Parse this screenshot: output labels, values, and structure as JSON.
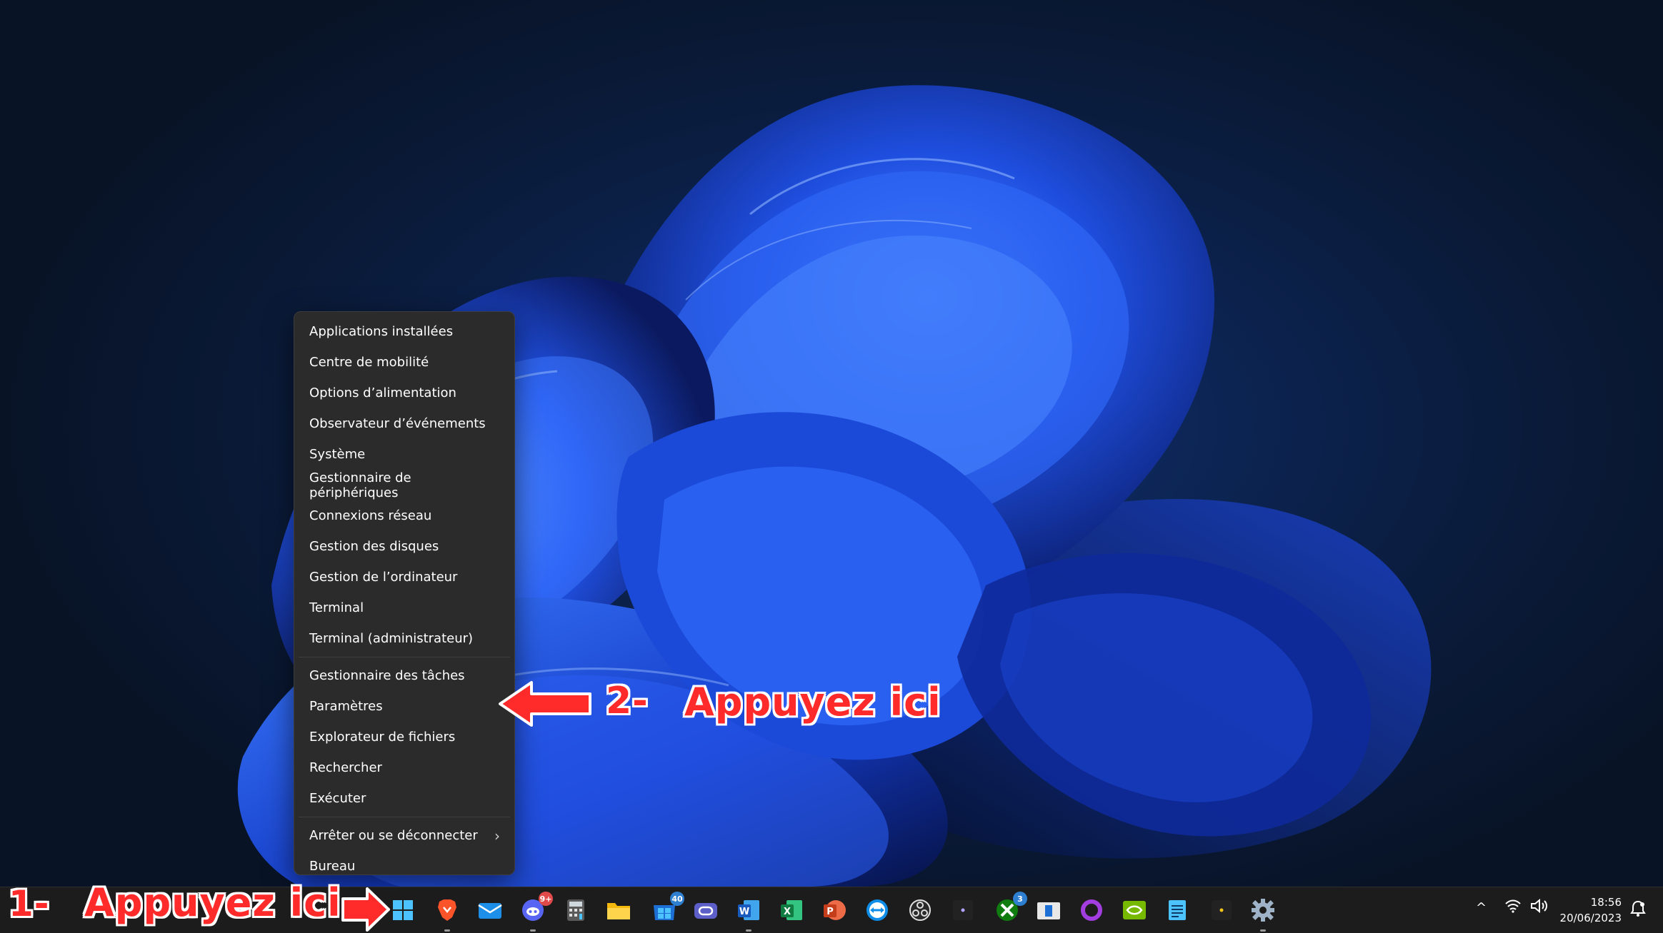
{
  "menu": {
    "group1": [
      {
        "label": "Applications installées"
      },
      {
        "label": "Centre de mobilité"
      },
      {
        "label": "Options d’alimentation"
      },
      {
        "label": "Observateur d’événements"
      },
      {
        "label": "Système"
      },
      {
        "label": "Gestionnaire de périphériques"
      },
      {
        "label": "Connexions réseau"
      },
      {
        "label": "Gestion des disques"
      },
      {
        "label": "Gestion de l’ordinateur"
      },
      {
        "label": "Terminal"
      },
      {
        "label": "Terminal (administrateur)"
      }
    ],
    "group2": [
      {
        "label": "Gestionnaire des tâches"
      },
      {
        "label": "Paramètres"
      },
      {
        "label": "Explorateur de fichiers"
      },
      {
        "label": "Rechercher"
      },
      {
        "label": "Exécuter"
      }
    ],
    "group3": [
      {
        "label": "Arrêter ou se déconnecter",
        "chevron": "›"
      },
      {
        "label": "Bureau"
      }
    ]
  },
  "annotations": {
    "step1_number": "1-",
    "step1_text": "Appuyez ici",
    "step2_number": "2-",
    "step2_text": "Appuyez ici",
    "color": "#ff2a2a"
  },
  "taskbar": {
    "apps": [
      {
        "icon": "windows-start-icon"
      },
      {
        "icon": "brave-browser-icon"
      },
      {
        "icon": "mail-icon"
      },
      {
        "icon": "discord-icon",
        "badge": "9+"
      },
      {
        "icon": "calculator-icon"
      },
      {
        "icon": "file-explorer-icon"
      },
      {
        "icon": "microsoft-store-icon",
        "badge": "40"
      },
      {
        "icon": "app-icon"
      },
      {
        "icon": "word-icon",
        "text": "W"
      },
      {
        "icon": "excel-icon",
        "text": "X"
      },
      {
        "icon": "powerpoint-icon",
        "text": "P"
      },
      {
        "icon": "teamviewer-icon"
      },
      {
        "icon": "obs-icon"
      },
      {
        "icon": "small-dot-icon"
      },
      {
        "icon": "xbox-icon",
        "badge": "3"
      },
      {
        "icon": "media-player-icon"
      },
      {
        "icon": "cortana-ring-icon"
      },
      {
        "icon": "nvidia-icon"
      },
      {
        "icon": "notepad-icon"
      },
      {
        "icon": "small-dot-icon-2"
      },
      {
        "icon": "settings-gear-icon"
      }
    ],
    "tray": {
      "chevron": "^",
      "time": "18:56",
      "date": "20/06/2023"
    }
  }
}
